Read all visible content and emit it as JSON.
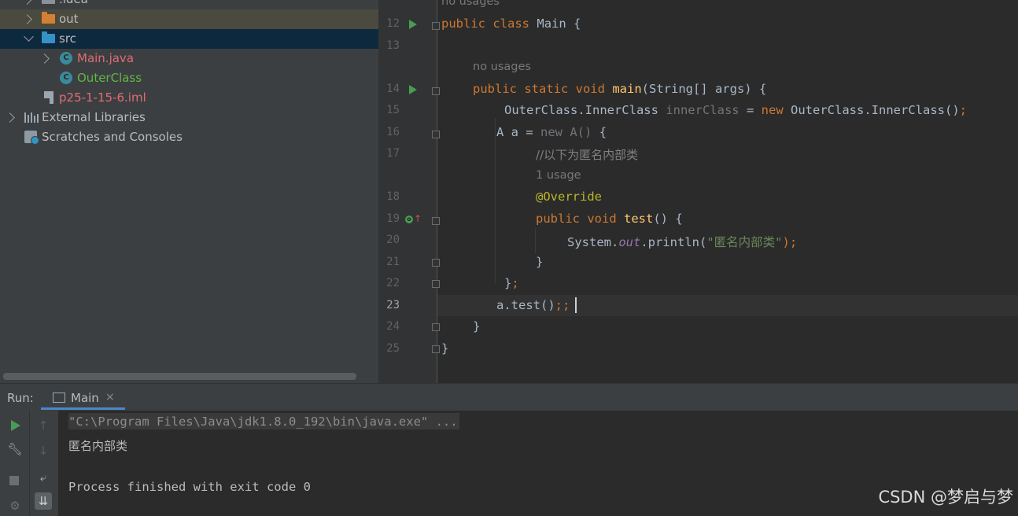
{
  "project_tree": {
    "items": [
      {
        "label": ".idea",
        "color": "#bbbbbb"
      },
      {
        "label": "out",
        "color": "#bbbbbb"
      },
      {
        "label": "src",
        "color": "#bbbbbb"
      },
      {
        "label": "Main.java",
        "color": "#e06c75"
      },
      {
        "label": "OuterClass",
        "color": "#62b543"
      },
      {
        "label": "p25-1-15-6.iml",
        "color": "#e06c75"
      },
      {
        "label": "External Libraries",
        "color": "#bbbbbb"
      },
      {
        "label": "Scratches and Consoles",
        "color": "#bbbbbb"
      }
    ],
    "class_icon_letter": "C"
  },
  "editor": {
    "line_numbers": [
      "12",
      "13",
      "14",
      "15",
      "16",
      "17",
      "18",
      "19",
      "20",
      "21",
      "22",
      "23",
      "24",
      "25"
    ],
    "current_line": "23",
    "hints": {
      "main_class_usages": "no usages",
      "main_method_usages": "no usages",
      "test_usages": "1 usage"
    },
    "code": {
      "l12_public": "public",
      "l12_class": "class",
      "l12_name": "Main",
      "l12_brace": "{",
      "l14_mods": "public static void",
      "l14_name": "main",
      "l14_params": "(String[] args) {",
      "l15_type": "OuterClass.InnerClass",
      "l15_var": "innerClass",
      "l15_eq": "=",
      "l15_new": "new",
      "l15_ctor": "OuterClass.InnerClass()",
      "l15_semi": ";",
      "l16_decl": "A a =",
      "l16_new": "new A()",
      "l16_brace": "{",
      "l17_comment": "//以下为匿名内部类",
      "l18_annotation": "@Override",
      "l19_mods": "public void",
      "l19_name": "test",
      "l19_rest": "() {",
      "l20_sys": "System.",
      "l20_out": "out",
      "l20_call": ".println(",
      "l20_str": "\"匿名内部类\"",
      "l20_end": ");",
      "l21_brace": "}",
      "l22_brace": "}",
      "l22_semi": ";",
      "l23_call": "a.test()",
      "l23_semis": ";;",
      "l24_brace": "}",
      "l25_brace": "}"
    }
  },
  "run_panel": {
    "title": "Run:",
    "tab_label": "Main",
    "tab_close": "×",
    "console_lines": {
      "command": "\"C:\\Program Files\\Java\\jdk1.8.0_192\\bin\\java.exe\" ...",
      "output": "匿名内部类",
      "exit": "Process finished with exit code 0"
    },
    "toolbar_icons": [
      "run-icon",
      "up-arrow-icon",
      "wrench-icon",
      "down-arrow-icon",
      "stop-icon",
      "soft-wrap-icon",
      "settings-icon",
      "scroll-to-end-icon"
    ]
  },
  "watermark": "CSDN @梦启与梦",
  "colors": {
    "keyword": "#cc7832",
    "method": "#ffc66d",
    "string": "#6a8759",
    "annotation": "#bbb529",
    "selection": "#0d293e",
    "run_green": "#499c54"
  }
}
